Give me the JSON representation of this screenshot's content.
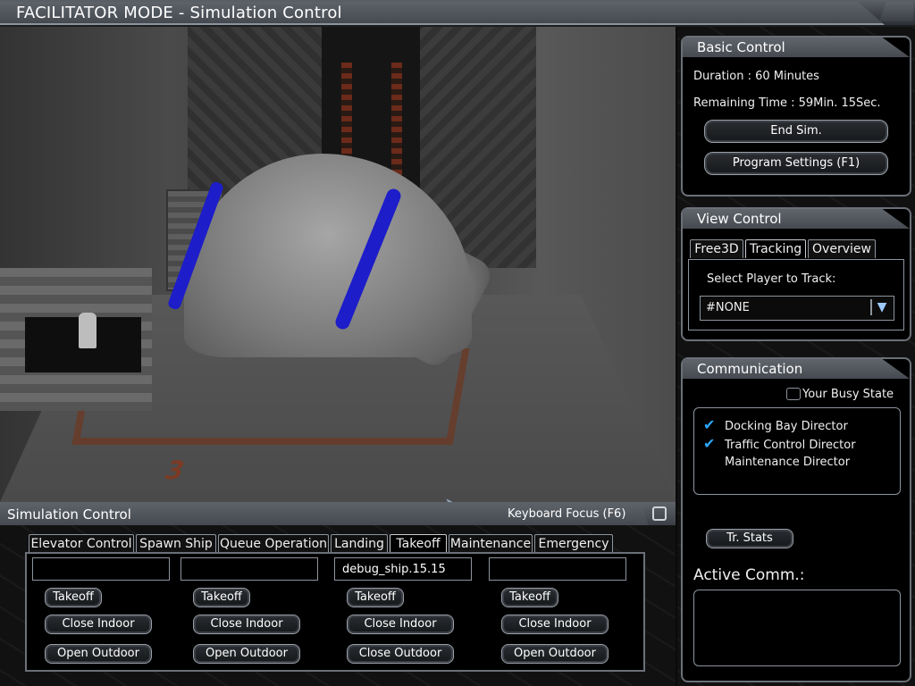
{
  "window": {
    "title": "FACILITATOR MODE - Simulation Control"
  },
  "basic_control": {
    "title": "Basic Control",
    "duration": "Duration : 60 Minutes",
    "remaining": "Remaining Time : 59Min. 15Sec.",
    "end_sim": "End Sim.",
    "program_settings": "Program Settings (F1)"
  },
  "view_control": {
    "title": "View Control",
    "tabs": [
      "Free3D",
      "Tracking",
      "Overview"
    ],
    "active_tab": "Tracking",
    "select_label": "Select Player to Track:",
    "select_value": "#NONE"
  },
  "communication": {
    "title": "Communication",
    "busy_state": "Your Busy State",
    "directors": [
      {
        "label": "Docking Bay Director",
        "checked": true
      },
      {
        "label": "Traffic Control Director",
        "checked": true
      },
      {
        "label": "Maintenance Director",
        "checked": false
      }
    ],
    "tr_stats": "Tr. Stats",
    "active_comm": "Active Comm.:"
  },
  "viewport": {
    "floor_label": "3"
  },
  "sim_control": {
    "title": "Simulation Control",
    "keyboard_focus": "Keyboard Focus (F6)",
    "tabs": [
      "Elevator Control",
      "Spawn Ship",
      "Queue Operation",
      "Landing",
      "Takeoff",
      "Maintenance",
      "Emergency"
    ],
    "active_tab": "Takeoff",
    "bays": [
      {
        "field": "",
        "takeoff": "Takeoff",
        "close_indoor": "Close Indoor",
        "outdoor": "Open Outdoor"
      },
      {
        "field": "",
        "takeoff": "Takeoff",
        "close_indoor": "Close Indoor",
        "outdoor": "Open Outdoor"
      },
      {
        "field": "debug_ship.15.15",
        "takeoff": "Takeoff",
        "close_indoor": "Close Indoor",
        "outdoor": "Close Outdoor"
      },
      {
        "field": "",
        "takeoff": "Takeoff",
        "close_indoor": "Close Indoor",
        "outdoor": "Open Outdoor"
      }
    ]
  }
}
